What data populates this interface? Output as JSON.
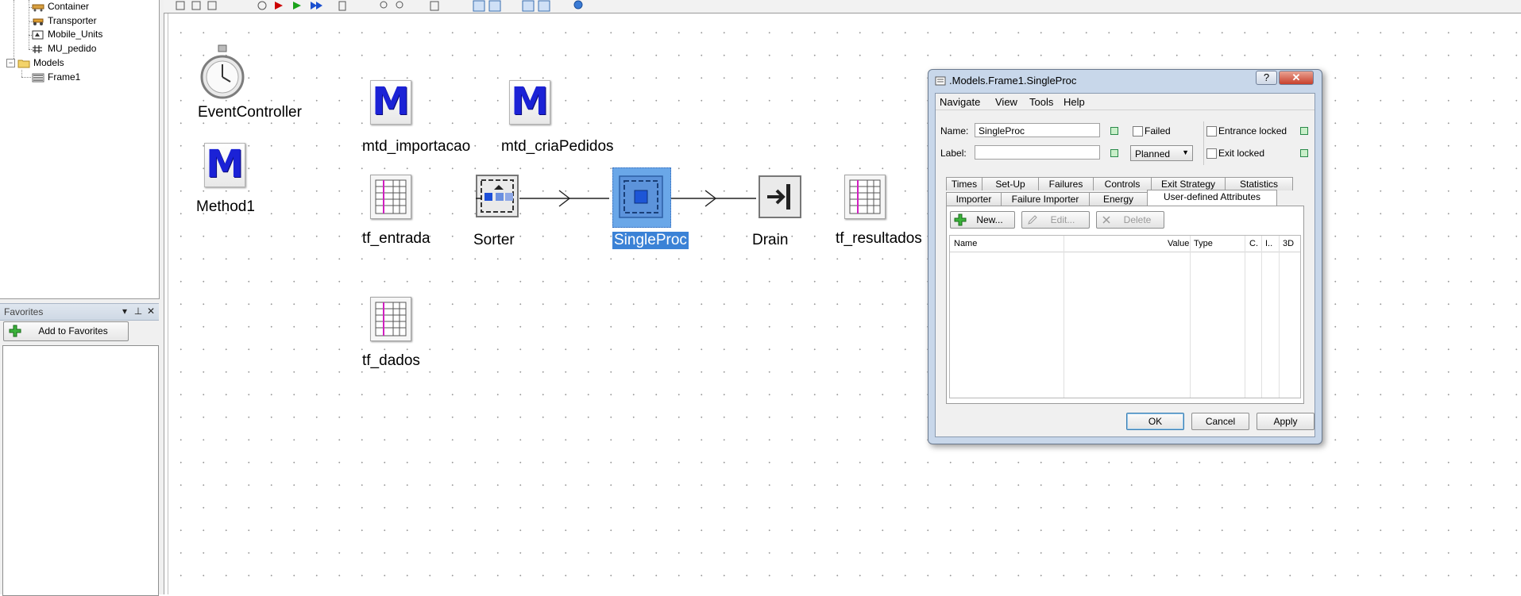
{
  "tree": {
    "items": [
      {
        "label": "Container"
      },
      {
        "label": "Transporter"
      },
      {
        "label": "Mobile_Units"
      },
      {
        "label": "MU_pedido"
      },
      {
        "label": "Models"
      },
      {
        "label": "Frame1"
      }
    ]
  },
  "favorites": {
    "title": "Favorites",
    "add_label": "Add to Favorites"
  },
  "canvas": {
    "objects": [
      {
        "label": "EventController"
      },
      {
        "label": "Method1"
      },
      {
        "label": "mtd_importacao"
      },
      {
        "label": "mtd_criaPedidos"
      },
      {
        "label": "tf_entrada"
      },
      {
        "label": "Sorter"
      },
      {
        "label": "SingleProc"
      },
      {
        "label": "Drain"
      },
      {
        "label": "tf_resultados"
      },
      {
        "label": "tf_dados"
      }
    ]
  },
  "dialog": {
    "title": ".Models.Frame1.SingleProc",
    "menu": [
      "Navigate",
      "View",
      "Tools",
      "Help"
    ],
    "name_label": "Name:",
    "name_value": "SingleProc",
    "label_label": "Label:",
    "label_value": "",
    "failed_label": "Failed",
    "entrance_locked_label": "Entrance locked",
    "exit_locked_label": "Exit locked",
    "planned_value": "Planned",
    "tabs_row1": [
      "Times",
      "Set-Up",
      "Failures",
      "Controls",
      "Exit Strategy",
      "Statistics"
    ],
    "tabs_row2": [
      "Importer",
      "Failure Importer",
      "Energy",
      "User-defined Attributes"
    ],
    "active_tab": "User-defined Attributes",
    "new_label": "New...",
    "edit_label": "Edit...",
    "delete_label": "Delete",
    "columns": [
      "Name",
      "Value",
      "Type",
      "C.",
      "I..",
      "3D"
    ],
    "ok_label": "OK",
    "cancel_label": "Cancel",
    "apply_label": "Apply",
    "help_glyph": "?",
    "close_glyph": "✕"
  },
  "colors": {
    "selection": "#3b82d6",
    "method_blue": "#1b22d6",
    "dialog_frame": "#c8d7ea"
  }
}
